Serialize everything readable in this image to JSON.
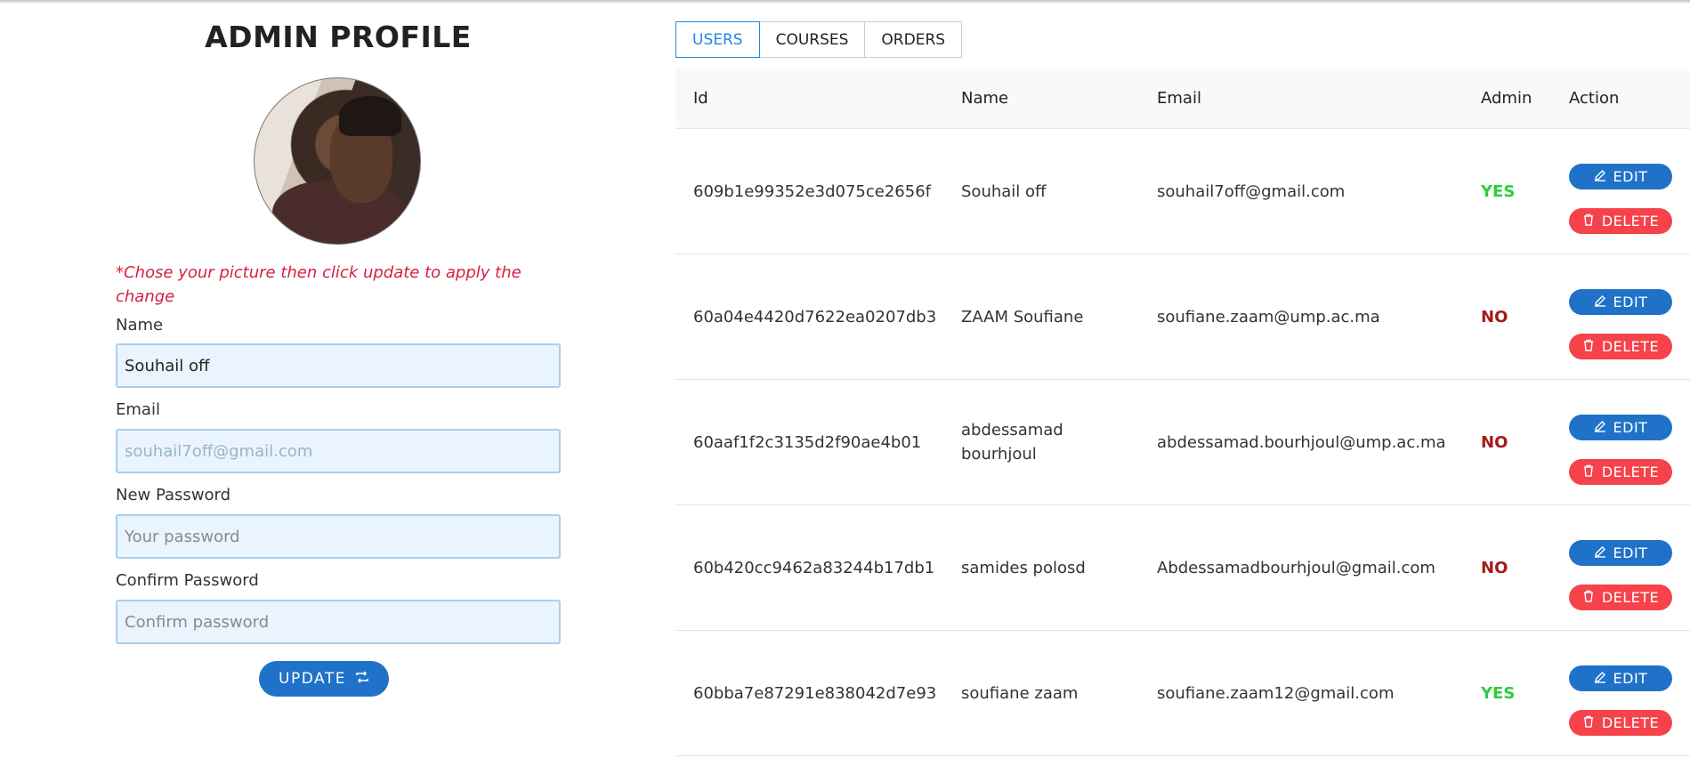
{
  "profile": {
    "title": "ADMIN PROFILE",
    "hint": "*Chose your picture then click update to apply the change",
    "name_label": "Name",
    "name_value": "Souhail off",
    "email_label": "Email",
    "email_placeholder": "souhail7off@gmail.com",
    "new_password_label": "New Password",
    "new_password_placeholder": "Your password",
    "confirm_password_label": "Confirm Password",
    "confirm_password_placeholder": "Confirm password",
    "update_label": "UPDATE",
    "update_icon": "refresh-icon"
  },
  "tabs": [
    {
      "label": "USERS",
      "active": true
    },
    {
      "label": "COURSES",
      "active": false
    },
    {
      "label": "ORDERS",
      "active": false
    }
  ],
  "table": {
    "headers": [
      "Id",
      "Name",
      "Email",
      "Admin",
      "Action"
    ],
    "edit_label": "EDIT",
    "delete_label": "DELETE",
    "rows": [
      {
        "id": "609b1e99352e3d075ce2656f",
        "name": "Souhail off",
        "email": "souhail7off@gmail.com",
        "admin": "YES"
      },
      {
        "id": "60a04e4420d7622ea0207db3",
        "name": "ZAAM Soufiane",
        "email": "soufiane.zaam@ump.ac.ma",
        "admin": "NO"
      },
      {
        "id": "60aaf1f2c3135d2f90ae4b01",
        "name": "abdessamad bourhjoul",
        "email": "abdessamad.bourhjoul@ump.ac.ma",
        "admin": "NO"
      },
      {
        "id": "60b420cc9462a83244b17db1",
        "name": "samides polosd",
        "email": "Abdessamadbourhjoul@gmail.com",
        "admin": "NO"
      },
      {
        "id": "60bba7e87291e838042d7e93",
        "name": "soufiane zaam",
        "email": "soufiane.zaam12@gmail.com",
        "admin": "YES"
      }
    ]
  },
  "colors": {
    "primary": "#1f72c8",
    "danger": "#f5424b",
    "yes": "#2ecc40",
    "no": "#a31b1b",
    "hint": "#d61f41"
  }
}
